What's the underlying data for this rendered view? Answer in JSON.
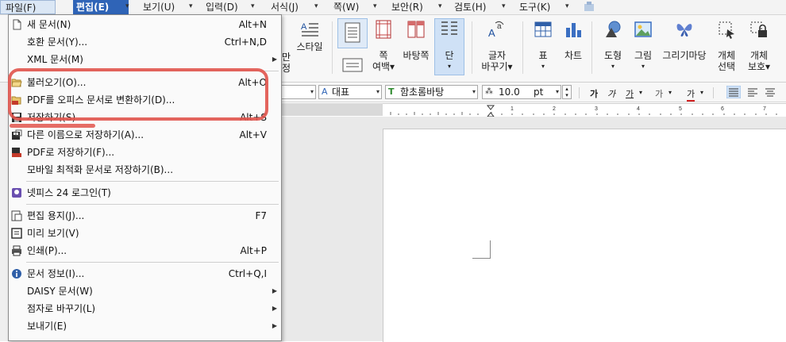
{
  "menubar": {
    "items": [
      "파일(F)",
      "편집(E)",
      "보기(U)",
      "입력(D)",
      "서식(J)",
      "쪽(W)",
      "보안(R)",
      "검토(H)",
      "도구(K)"
    ]
  },
  "ribbon": {
    "buttons": [
      {
        "label1": "스타일",
        "label2": ""
      },
      {
        "label1": "쪽",
        "label2": "여백▾"
      },
      {
        "label1": "바탕쪽",
        "label2": ""
      },
      {
        "label1": "단",
        "label2": "▾"
      },
      {
        "label1": "글자",
        "label2": "바꾸기▾"
      },
      {
        "label1": "표",
        "label2": "▾"
      },
      {
        "label1": "차트",
        "label2": ""
      },
      {
        "label1": "도형",
        "label2": "▾"
      },
      {
        "label1": "그림",
        "label2": "▾"
      },
      {
        "label1": "그리기마당",
        "label2": ""
      },
      {
        "label1": "개체",
        "label2": "선택"
      },
      {
        "label1": "개체",
        "label2": "보호▾"
      }
    ],
    "partial_labels": [
      "만",
      "정"
    ]
  },
  "format_bar": {
    "style_value": "대표",
    "font_value": "함초롬바탕",
    "size_value": "10.0",
    "size_unit": "pt",
    "text_buttons": [
      "가",
      "가",
      "가",
      "가"
    ]
  },
  "file_menu": {
    "items": [
      {
        "label": "새 문서(N)",
        "shortcut": "Alt+N",
        "submenu": false,
        "icon": "new-document-icon"
      },
      {
        "label": "호환 문서(Y)...",
        "shortcut": "Ctrl+N,D",
        "submenu": false,
        "icon": ""
      },
      {
        "label": "XML 문서(M)",
        "shortcut": "",
        "submenu": true,
        "icon": ""
      },
      {
        "label": "불러오기(O)...",
        "shortcut": "Alt+O",
        "submenu": false,
        "icon": "open-folder-icon"
      },
      {
        "label": "PDF를 오피스 문서로 변환하기(D)...",
        "shortcut": "",
        "submenu": false,
        "icon": "pdf-convert-icon"
      },
      {
        "label": "저장하기(S)",
        "shortcut": "Alt+S",
        "submenu": false,
        "icon": "save-icon"
      },
      {
        "label": "다른 이름으로 저장하기(A)...",
        "shortcut": "Alt+V",
        "submenu": false,
        "icon": "save-as-icon"
      },
      {
        "label": "PDF로 저장하기(F)...",
        "shortcut": "",
        "submenu": false,
        "icon": "save-pdf-icon"
      },
      {
        "label": "모바일 최적화 문서로 저장하기(B)...",
        "shortcut": "",
        "submenu": false,
        "icon": ""
      },
      {
        "label": "넷피스 24 로그인(T)",
        "shortcut": "",
        "submenu": false,
        "icon": "netffice-login-icon"
      },
      {
        "label": "편집 용지(J)...",
        "shortcut": "F7",
        "submenu": false,
        "icon": "page-setup-icon"
      },
      {
        "label": "미리 보기(V)",
        "shortcut": "",
        "submenu": false,
        "icon": "preview-icon"
      },
      {
        "label": "인쇄(P)...",
        "shortcut": "Alt+P",
        "submenu": false,
        "icon": "print-icon"
      },
      {
        "label": "문서 정보(I)...",
        "shortcut": "Ctrl+Q,I",
        "submenu": false,
        "icon": "document-info-icon"
      },
      {
        "label": "DAISY 문서(W)",
        "shortcut": "",
        "submenu": true,
        "icon": ""
      },
      {
        "label": "점자로 바꾸기(L)",
        "shortcut": "",
        "submenu": true,
        "icon": ""
      },
      {
        "label": "보내기(E)",
        "shortcut": "",
        "submenu": true,
        "icon": ""
      }
    ]
  },
  "colors": {
    "accent": "#2f64b7",
    "highlight": "#e0534b",
    "menu_bg": "#fafafa"
  }
}
